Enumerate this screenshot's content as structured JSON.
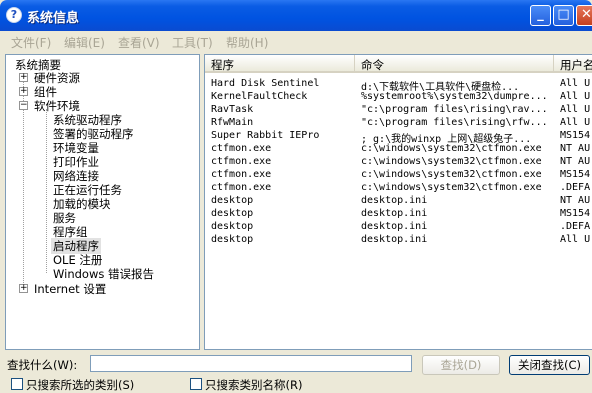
{
  "window": {
    "title": "系统信息"
  },
  "menu": [
    "文件(F)",
    "编辑(E)",
    "查看(V)",
    "工具(T)",
    "帮助(H)"
  ],
  "tree": {
    "root": "系统摘要",
    "items": [
      {
        "label": "硬件资源",
        "expander": "+"
      },
      {
        "label": "组件",
        "expander": "+"
      },
      {
        "label": "软件环境",
        "expander": "−"
      }
    ],
    "children": [
      "系统驱动程序",
      "签署的驱动程序",
      "环境变量",
      "打印作业",
      "网络连接",
      "正在运行任务",
      "加载的模块",
      "服务",
      "程序组",
      "启动程序",
      "OLE 注册",
      "Windows 错误报告"
    ],
    "selected_child": "启动程序",
    "last": {
      "label": "Internet 设置",
      "expander": "+"
    }
  },
  "table": {
    "columns": [
      "程序",
      "命令",
      "用户名"
    ],
    "rows": [
      [
        "Hard Disk Sentinel",
        "d:\\下载软件\\工具软件\\硬盘检...",
        "All U"
      ],
      [
        "KernelFaultCheck",
        "%systemroot%\\system32\\dumpre...",
        "All U"
      ],
      [
        "RavTask",
        "\"c:\\program files\\rising\\rav...",
        "All U"
      ],
      [
        "RfwMain",
        "\"c:\\program files\\rising\\rfw...",
        "All U"
      ],
      [
        "Super Rabbit IEPro",
        "; g:\\我的winxp 上网\\超级兔子...",
        "MS154"
      ],
      [
        "ctfmon.exe",
        "c:\\windows\\system32\\ctfmon.exe",
        "NT AU"
      ],
      [
        "ctfmon.exe",
        "c:\\windows\\system32\\ctfmon.exe",
        "NT AU"
      ],
      [
        "ctfmon.exe",
        "c:\\windows\\system32\\ctfmon.exe",
        "MS154"
      ],
      [
        "ctfmon.exe",
        "c:\\windows\\system32\\ctfmon.exe",
        ".DEFA"
      ],
      [
        "desktop",
        "desktop.ini",
        "NT AU"
      ],
      [
        "desktop",
        "desktop.ini",
        "MS154"
      ],
      [
        "desktop",
        "desktop.ini",
        ".DEFA"
      ],
      [
        "desktop",
        "desktop.ini",
        "All U"
      ]
    ]
  },
  "find": {
    "label": "查找什么(W):",
    "value": "",
    "find_button": "查找(D)",
    "close_button": "关闭查找(C)",
    "check1": "只搜索所选的类别(S)",
    "check2": "只搜索类别名称(R)"
  }
}
